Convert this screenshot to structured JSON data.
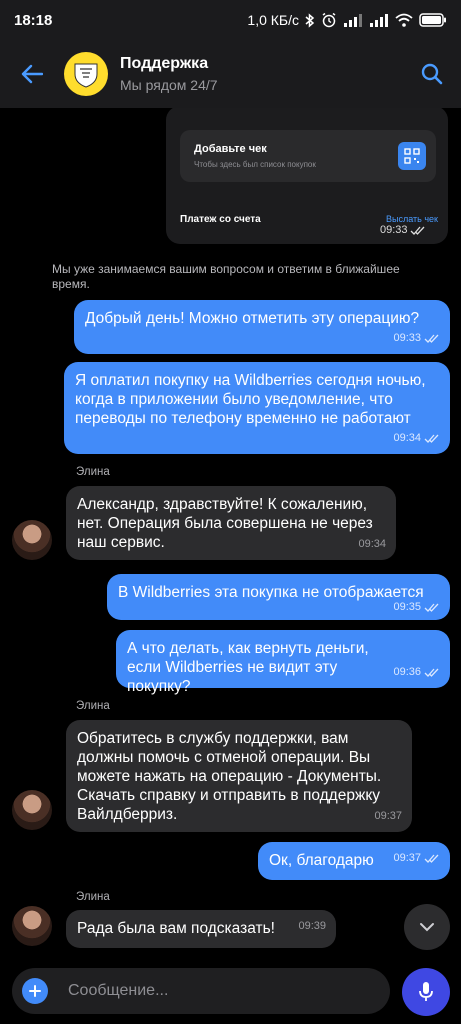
{
  "status_bar": {
    "time": "18:18",
    "net_speed": "1,0 КБ/с"
  },
  "header": {
    "title": "Поддержка",
    "subtitle": "Мы рядом 24/7"
  },
  "receipt_card": {
    "title": "Добавьте чек",
    "subtitle": "Чтобы здесь был список покупок",
    "payment_label": "Платеж со счета",
    "payment_link": "Выслать чек",
    "time": "09:33"
  },
  "system_message": "Мы уже занимаемся вашим вопросом и ответим в ближайшее время.",
  "messages": [
    {
      "text": "Добрый день! Можно отметить эту операцию?",
      "time": "09:33"
    },
    {
      "text": "Я оплатил покупку на Wildberries сегодня ночью, когда в приложении было уведомление, что переводы по телефону временно не работают",
      "time": "09:34"
    },
    {
      "sender": "Элина",
      "text": "Александр, здравствуйте! К сожалению, нет. Операция была совершена не через наш сервис.",
      "time": "09:34"
    },
    {
      "text": "В Wildberries эта покупка не отображается",
      "time": "09:35"
    },
    {
      "text": "А что делать, как вернуть деньги, если Wildberries не видит эту покупку?",
      "time": "09:36"
    },
    {
      "sender": "Элина",
      "text": "Обратитесь в службу поддержки, вам должны помочь с отменой операции. Вы можете нажать на операцию - Документы. Скачать справку и отправить в поддержку Вайлдберриз.",
      "time": "09:37"
    },
    {
      "text": "Ок, благодарю",
      "time": "09:37"
    },
    {
      "sender": "Элина",
      "text": "Рада была вам подсказать!",
      "time": "09:39"
    }
  ],
  "input": {
    "placeholder": "Сообщение..."
  },
  "colors": {
    "outgoing_bubble": "#428bf9",
    "incoming_bubble": "#2c2c2e",
    "accent": "#4a9bff",
    "mic_button": "#3f48e3",
    "brand_yellow": "#ffdd2d"
  }
}
